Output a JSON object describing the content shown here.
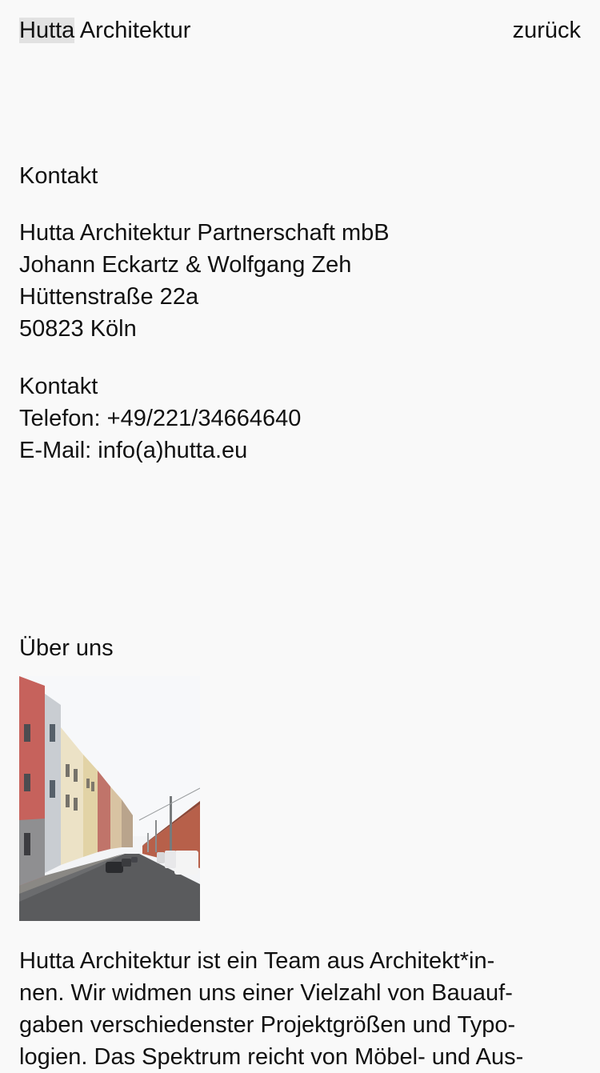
{
  "header": {
    "logo_part1": "Hutta",
    "logo_part2": " Architektur",
    "back_label": "zurück"
  },
  "contact": {
    "title": "Kontakt",
    "address": [
      "Hutta Architektur Partnerschaft mbB",
      "Johann Eckartz & Wolfgang Zeh",
      "Hüttenstraße 22a",
      "50823 Köln"
    ],
    "contact_label": "Kontakt",
    "phone": "Telefon: +49/221/34664640",
    "email": "E-Mail: info(a)hutta.eu"
  },
  "about": {
    "title": "Über uns",
    "image_icon": "street-photo",
    "text_lines": [
      "Hutta Architektur ist ein Team aus Architekt*in-",
      "nen. Wir widmen uns einer Vielzahl von Bauauf-",
      "gaben verschiedenster Projektgrößen und Typo-",
      "logien. Das Spektrum reicht von Möbel- und Aus-"
    ]
  },
  "colors": {
    "background": "#f9f9f9",
    "text": "#111111",
    "logo_highlight": "#e2e2e2"
  }
}
